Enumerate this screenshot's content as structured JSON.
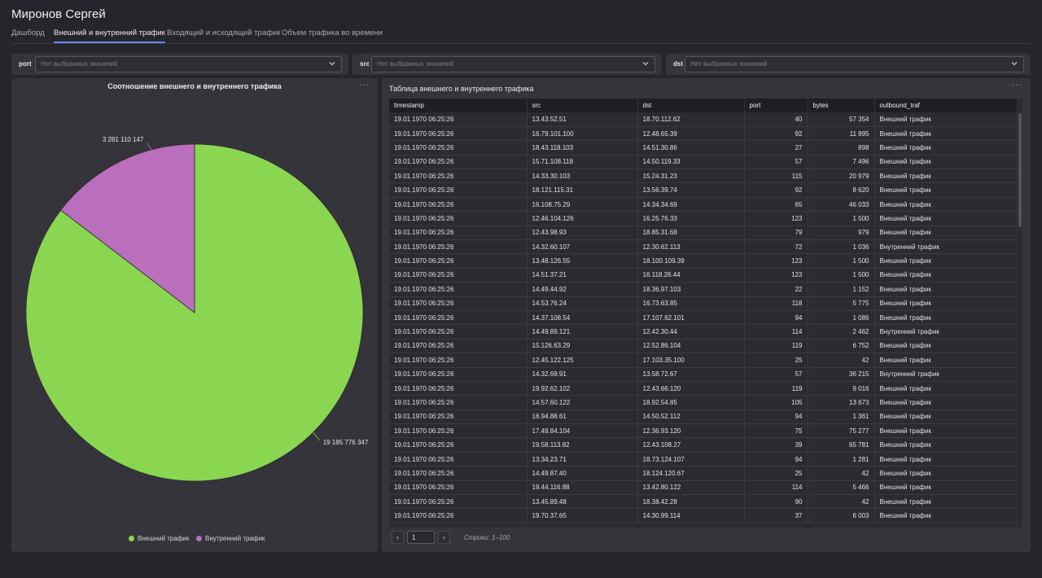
{
  "header": {
    "title": "Миронов Сергей"
  },
  "tabs": [
    {
      "label": "Дашборд"
    },
    {
      "label": "Внешний и внутренний трафик"
    },
    {
      "label": "Входящий и исходящий трафик"
    },
    {
      "label": "Объем трафика во времени"
    }
  ],
  "filters": [
    {
      "label": "port",
      "placeholder": "Нет выбранных значений"
    },
    {
      "label": "src",
      "placeholder": "Нет выбранных значений"
    },
    {
      "label": "dst",
      "placeholder": "Нет выбранных значений"
    }
  ],
  "pie_panel": {
    "title": "Соотношение внешнего и внутреннего трафика",
    "menu": "···"
  },
  "chart_data": {
    "type": "pie",
    "title": "Соотношение внешнего и внутреннего трафика",
    "series": [
      {
        "name": "Внешний трафик",
        "value": 19185776347,
        "label": "19 185 776 347",
        "color": "#8ad651"
      },
      {
        "name": "Внутренний трафик",
        "value": 3281110147,
        "label": "3 281 110 147",
        "color": "#b96fbb"
      }
    ],
    "legend_position": "bottom"
  },
  "table_panel": {
    "title": "Таблица внешнего и внутреннего трафика",
    "menu": "···",
    "columns": [
      "timestamp",
      "src",
      "dst",
      "port",
      "bytes",
      "outbound_traf"
    ],
    "rows": [
      [
        "19.01.1970 06:25:26",
        "13.43.52.51",
        "18.70.112.62",
        "40",
        "57 354",
        "Внешний трафик"
      ],
      [
        "19.01.1970 06:25:26",
        "16.79.101.100",
        "12.48.65.39",
        "92",
        "11 895",
        "Внешний трафик"
      ],
      [
        "19.01.1970 06:25:26",
        "18.43.118.103",
        "14.51.30.86",
        "27",
        "898",
        "Внешний трафик"
      ],
      [
        "19.01.1970 06:25:26",
        "15.71.108.118",
        "14.50.119.33",
        "57",
        "7 496",
        "Внешний трафик"
      ],
      [
        "19.01.1970 06:25:26",
        "14.33.30.103",
        "15.24.31.23",
        "115",
        "20 979",
        "Внешний трафик"
      ],
      [
        "19.01.1970 06:25:26",
        "18.121.115.31",
        "13.56.39.74",
        "92",
        "8 620",
        "Внешний трафик"
      ],
      [
        "19.01.1970 06:25:26",
        "16.108.75.29",
        "14.34.34.69",
        "65",
        "46 033",
        "Внешний трафик"
      ],
      [
        "19.01.1970 06:25:26",
        "12.46.104.126",
        "16.25.76.33",
        "123",
        "1 500",
        "Внешний трафик"
      ],
      [
        "19.01.1970 06:25:26",
        "12.43.98.93",
        "18.85.31.68",
        "79",
        "979",
        "Внешний трафик"
      ],
      [
        "19.01.1970 06:25:26",
        "14.32.60.107",
        "12.30.62.113",
        "72",
        "1 036",
        "Внутренний трафик"
      ],
      [
        "19.01.1970 06:25:26",
        "13.48.126.55",
        "18.100.109.39",
        "123",
        "1 500",
        "Внешний трафик"
      ],
      [
        "19.01.1970 06:25:26",
        "14.51.37.21",
        "16.118.26.44",
        "123",
        "1 500",
        "Внешний трафик"
      ],
      [
        "19.01.1970 06:25:26",
        "14.49.44.92",
        "18.36.97.103",
        "22",
        "1 152",
        "Внешний трафик"
      ],
      [
        "19.01.1970 06:25:26",
        "14.53.76.24",
        "16.73.63.85",
        "118",
        "5 775",
        "Внешний трафик"
      ],
      [
        "19.01.1970 06:25:26",
        "14.37.108.54",
        "17.107.62.101",
        "94",
        "1 086",
        "Внешний трафик"
      ],
      [
        "19.01.1970 06:25:26",
        "14.49.89.121",
        "12.42.30.44",
        "114",
        "2 462",
        "Внутренний трафик"
      ],
      [
        "19.01.1970 06:25:26",
        "15.126.63.29",
        "12.52.86.104",
        "119",
        "6 752",
        "Внешний трафик"
      ],
      [
        "19.01.1970 06:25:26",
        "12.45.122.125",
        "17.103.35.100",
        "25",
        "42",
        "Внешний трафик"
      ],
      [
        "19.01.1970 06:25:26",
        "14.32.69.91",
        "13.58.72.67",
        "57",
        "36 215",
        "Внутренний трафик"
      ],
      [
        "19.01.1970 06:25:26",
        "19.92.62.102",
        "12.43.66.120",
        "119",
        "9 016",
        "Внешний трафик"
      ],
      [
        "19.01.1970 06:25:26",
        "14.57.60.122",
        "18.92.54.85",
        "105",
        "13 673",
        "Внешний трафик"
      ],
      [
        "19.01.1970 06:25:26",
        "16.94.88.61",
        "14.50.52.112",
        "94",
        "1 361",
        "Внешний трафик"
      ],
      [
        "19.01.1970 06:25:26",
        "17.49.84.104",
        "12.36.93.120",
        "75",
        "75 277",
        "Внешний трафик"
      ],
      [
        "19.01.1970 06:25:26",
        "19.58.113.82",
        "12.43.108.27",
        "39",
        "65 781",
        "Внешний трафик"
      ],
      [
        "19.01.1970 06:25:26",
        "13.34.23.71",
        "18.73.124.107",
        "94",
        "1 281",
        "Внешний трафик"
      ],
      [
        "19.01.1970 06:25:26",
        "14.49.87.40",
        "18.124.120.67",
        "25",
        "42",
        "Внешний трафик"
      ],
      [
        "19.01.1970 06:25:26",
        "19.44.116.88",
        "13.42.80.122",
        "114",
        "5 466",
        "Внешний трафик"
      ],
      [
        "19.01.1970 06:25:26",
        "13.45.89.48",
        "18.38.42.28",
        "90",
        "42",
        "Внешний трафик"
      ],
      [
        "19.01.1970 06:25:26",
        "19.70.37.65",
        "14.30.99.114",
        "37",
        "6 003",
        "Внешний трафик"
      ]
    ]
  },
  "pagination": {
    "page": "1",
    "info": "Строки: 1–100",
    "prev": "‹",
    "next": "›"
  }
}
